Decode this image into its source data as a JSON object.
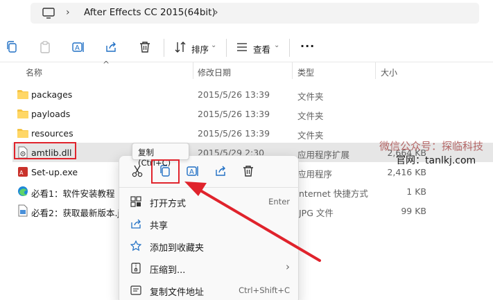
{
  "address": {
    "path": "After Effects CC 2015(64bit)"
  },
  "toolbar": {
    "sort_label": "排序",
    "view_label": "查看",
    "more_label": "···"
  },
  "columns": {
    "name": "名称",
    "date": "修改日期",
    "type": "类型",
    "size": "大小"
  },
  "files": [
    {
      "name": "packages",
      "date": "2015/5/26 13:39",
      "type": "文件夹",
      "size": "",
      "icon": "folder-icon"
    },
    {
      "name": "payloads",
      "date": "2015/5/26 13:39",
      "type": "文件夹",
      "size": "",
      "icon": "folder-icon"
    },
    {
      "name": "resources",
      "date": "2015/5/26 13:39",
      "type": "文件夹",
      "size": "",
      "icon": "folder-icon"
    },
    {
      "name": "amtlib.dll",
      "date": "2015/5/29 2:30",
      "type": "应用程序扩展",
      "size": "2,664 KB",
      "icon": "dll-file-icon"
    },
    {
      "name": "Set-up.exe",
      "date": "",
      "type": "应用程序",
      "size": "2,416 KB",
      "icon": "exe-file-icon"
    },
    {
      "name": "必看1：软件安装教程（",
      "date": "",
      "type": "nternet 快捷方式",
      "size": "1 KB",
      "icon": "edge-shortcut-icon"
    },
    {
      "name": "必看2：获取最新版本.jp",
      "date": "",
      "type": "JPG 文件",
      "size": "99 KB",
      "icon": "image-file-icon"
    }
  ],
  "tooltip": "复制 (Ctrl+C)",
  "context_menu": {
    "items": [
      {
        "label": "打开方式",
        "shortcut": "Enter"
      },
      {
        "label": "共享",
        "shortcut": ""
      },
      {
        "label": "添加到收藏夹",
        "shortcut": ""
      },
      {
        "label": "压缩到...",
        "shortcut": "›"
      },
      {
        "label": "复制文件地址",
        "shortcut": "Ctrl+Shift+C"
      }
    ]
  },
  "watermark": {
    "line1": "微信公众号：探临科技",
    "line2": "官网：tanlkj.com"
  },
  "colors": {
    "highlight_red": "#e0232c",
    "folder_yellow": "#f5c342",
    "selection_gray": "#e6e6e6"
  }
}
